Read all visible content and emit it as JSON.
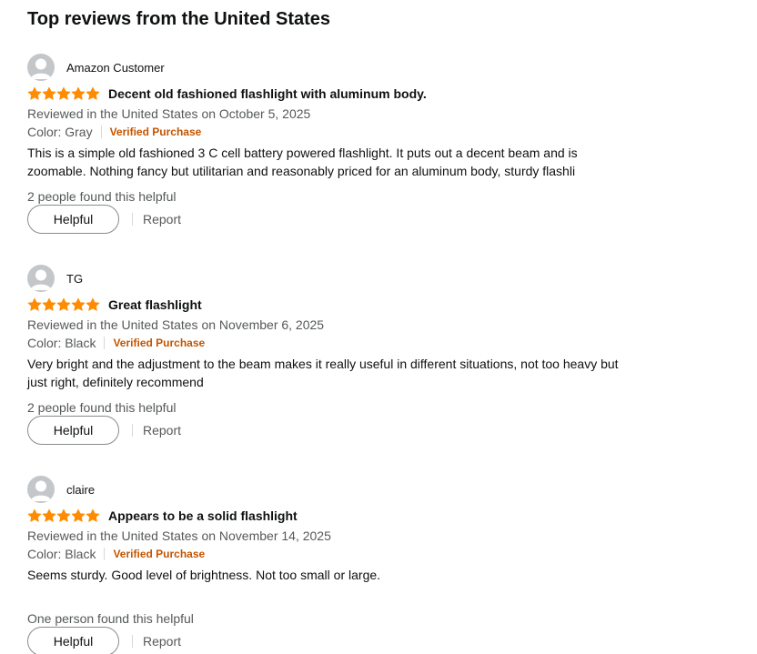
{
  "section_title": "Top reviews from the United States",
  "colors": {
    "star": "#ff8c00",
    "verified": "#c45500",
    "muted": "#565959"
  },
  "reviews": [
    {
      "author": "Amazon Customer",
      "rating": 5,
      "title": "Decent old fashioned flashlight with aluminum body.",
      "date": "Reviewed in the United States on October 5, 2025",
      "variant": "Color: Gray",
      "verified": "Verified Purchase",
      "body": "This is a simple old fashioned 3 C cell battery powered flashlight. It puts out a decent beam and is\nzoomable. Nothing fancy but utilitarian and reasonably priced for an aluminum body, sturdy flashli",
      "helpful_count": "2 people found this helpful",
      "helpful_label": "Helpful",
      "report_label": "Report"
    },
    {
      "author": "TG",
      "rating": 5,
      "title": "Great flashlight",
      "date": "Reviewed in the United States on November 6, 2025",
      "variant": "Color: Black",
      "verified": "Verified Purchase",
      "body": "Very bright and the adjustment to the beam makes it really useful in different situations, not too heavy but\njust right, definitely recommend",
      "helpful_count": "2 people found this helpful",
      "helpful_label": "Helpful",
      "report_label": "Report"
    },
    {
      "author": "claire",
      "rating": 5,
      "title": "Appears to be a solid flashlight",
      "date": "Reviewed in the United States on November 14, 2025",
      "variant": "Color: Black",
      "verified": "Verified Purchase",
      "body": "Seems sturdy. Good level of brightness. Not too small or large.",
      "helpful_count": "One person found this helpful",
      "helpful_label": "Helpful",
      "report_label": "Report"
    }
  ]
}
